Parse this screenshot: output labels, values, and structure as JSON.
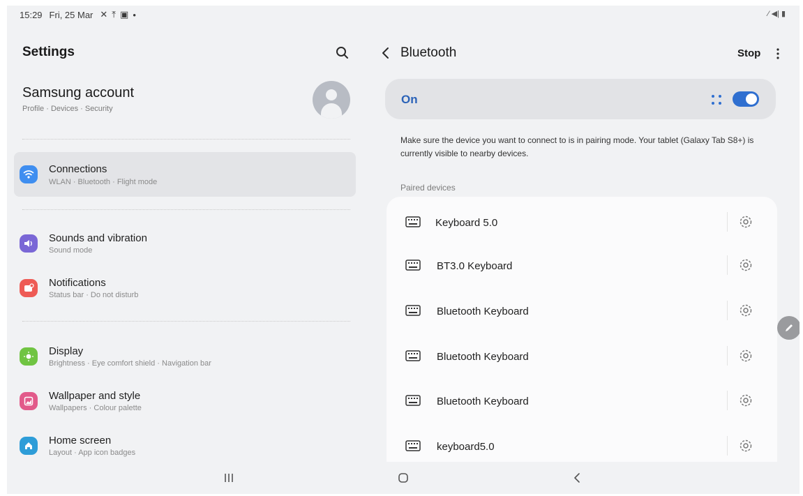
{
  "status": {
    "time": "15:29",
    "date": "Fri, 25 Mar",
    "right_text": "⁄ ◀| ▮"
  },
  "left": {
    "title": "Settings",
    "account": {
      "title": "Samsung account",
      "subtitle": "Profile · Devices · Security"
    },
    "items": [
      {
        "title": "Connections",
        "subtitle": "WLAN · Bluetooth · Flight mode",
        "icon": "wifi-icon",
        "color": "#3f8ef0",
        "active": true
      },
      {
        "title": "Sounds and vibration",
        "subtitle": "Sound mode",
        "icon": "volume-icon",
        "color": "#7a67d6"
      },
      {
        "title": "Notifications",
        "subtitle": "Status bar · Do not disturb",
        "icon": "notification-icon",
        "color": "#ee5b55"
      },
      {
        "title": "Display",
        "subtitle": "Brightness · Eye comfort shield · Navigation bar",
        "icon": "sun-icon",
        "color": "#70c442"
      },
      {
        "title": "Wallpaper and style",
        "subtitle": "Wallpapers · Colour palette",
        "icon": "wallpaper-icon",
        "color": "#e25a8a"
      },
      {
        "title": "Home screen",
        "subtitle": "Layout · App icon badges",
        "icon": "home-icon",
        "color": "#2e9dd8"
      }
    ]
  },
  "right": {
    "title": "Bluetooth",
    "stop_label": "Stop",
    "toggle_label": "On",
    "toggle_on": true,
    "info_text": "Make sure the device you want to connect to is in pairing mode. Your tablet (Galaxy Tab S8+) is currently visible to nearby devices.",
    "section_label": "Paired devices",
    "devices": [
      {
        "name": "Keyboard 5.0"
      },
      {
        "name": "BT3.0 Keyboard"
      },
      {
        "name": "Bluetooth Keyboard"
      },
      {
        "name": "Bluetooth Keyboard"
      },
      {
        "name": "Bluetooth Keyboard"
      },
      {
        "name": "keyboard5.0"
      }
    ]
  },
  "colors": {
    "accent": "#2f6fd0",
    "on_label": "#2b63b8"
  }
}
